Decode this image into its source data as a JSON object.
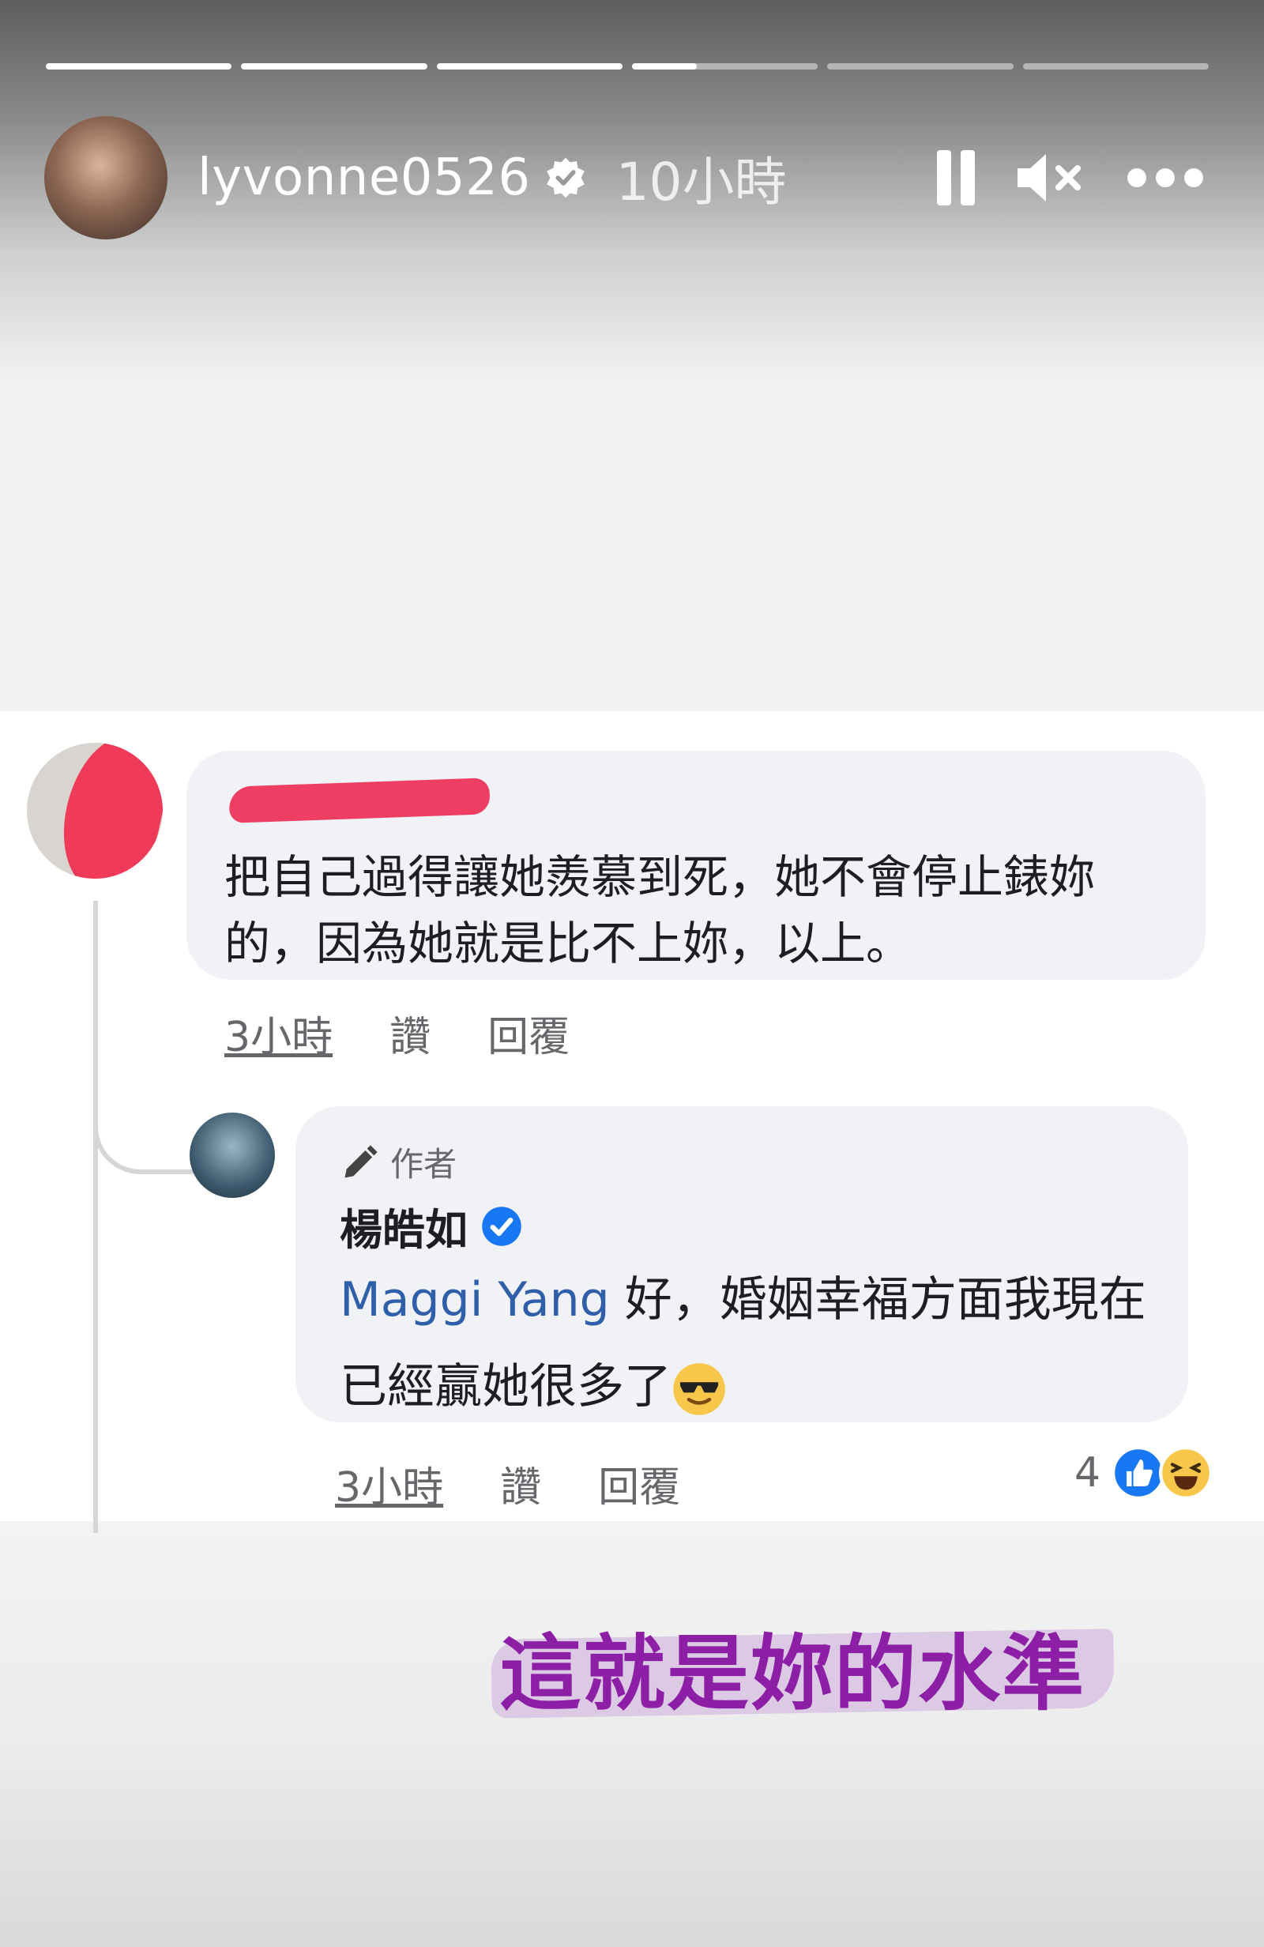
{
  "story": {
    "progress": [
      1,
      1,
      1,
      0.35,
      0,
      0
    ]
  },
  "header": {
    "username": "lyvonne0526",
    "time": "10小時"
  },
  "comment": {
    "text": "把自己過得讓她羨慕到死，她不會停止錶妳的，因為她就是比不上妳，以上。",
    "time": "3小時",
    "like_label": "讚",
    "reply_label": "回覆"
  },
  "reply": {
    "author_tag": "作者",
    "author_name": "楊皓如",
    "mention": "Maggi Yang",
    "text": " 好，婚姻幸福方面我現在已經贏她很多了",
    "time": "3小時",
    "like_label": "讚",
    "reply_label": "回覆",
    "reaction_count": "4"
  },
  "caption": {
    "text": "這就是妳的水準"
  },
  "colors": {
    "accent_blue": "#1877f2",
    "caption_purple": "#8c1fa5",
    "redaction_pink": "#ef3e63"
  }
}
